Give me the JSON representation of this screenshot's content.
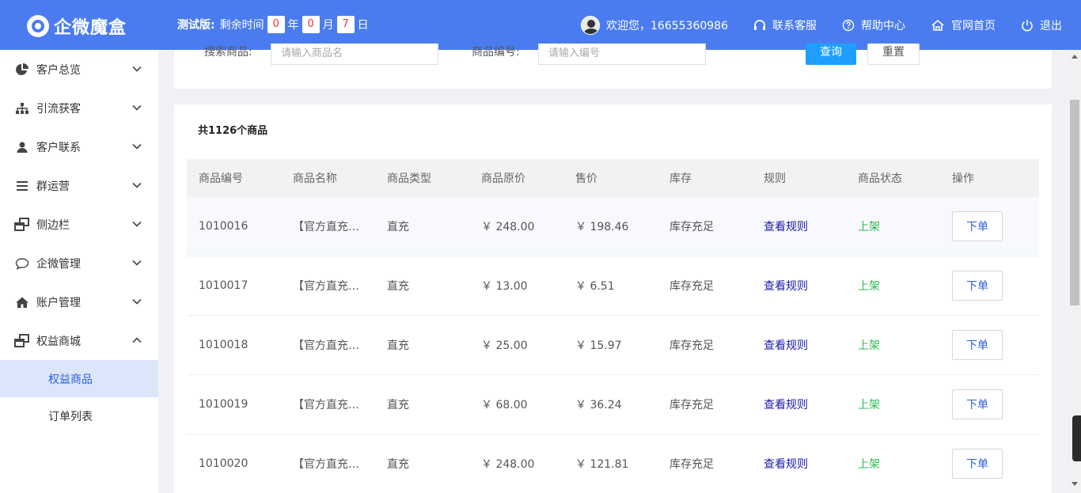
{
  "header": {
    "logo_text": "企微魔盒",
    "trial_label": "测试版:",
    "remaining_label": "剩余时间",
    "years": "0",
    "year_unit": "年",
    "months": "0",
    "month_unit": "月",
    "days": "7",
    "day_unit": "日",
    "welcome": "欢迎您，16655360986",
    "support": "联系客服",
    "help": "帮助中心",
    "home": "官网首页",
    "logout": "退出"
  },
  "sidebar": {
    "items": [
      {
        "label": "客户总览",
        "icon": "pie-chart-icon"
      },
      {
        "label": "引流获客",
        "icon": "sitemap-icon"
      },
      {
        "label": "客户联系",
        "icon": "user-icon"
      },
      {
        "label": "群运营",
        "icon": "list-icon"
      },
      {
        "label": "侧边栏",
        "icon": "windows-icon"
      },
      {
        "label": "企微管理",
        "icon": "chat-bubble-icon"
      },
      {
        "label": "账户管理",
        "icon": "home-icon"
      },
      {
        "label": "权益商城",
        "icon": "windows-icon"
      }
    ],
    "sub_items": [
      {
        "label": "权益商品",
        "active": true
      },
      {
        "label": "订单列表",
        "active": false
      }
    ]
  },
  "search": {
    "product_label": "搜索商品:",
    "product_placeholder": "请输入商品名",
    "code_label": "商品编号:",
    "code_placeholder": "请输入编号",
    "query_button": "查询",
    "reset_button": "重置"
  },
  "table": {
    "count_text": "共1126个商品",
    "headers": [
      "商品编号",
      "商品名称",
      "商品类型",
      "商品原价",
      "售价",
      "库存",
      "规则",
      "商品状态",
      "操作"
    ],
    "rows": [
      {
        "id": "1010016",
        "name": "【官方直充…",
        "type": "直充",
        "orig": "￥ 248.00",
        "price": "￥ 198.46",
        "stock": "库存充足",
        "rule": "查看规则",
        "status": "上架",
        "action": "下单"
      },
      {
        "id": "1010017",
        "name": "【官方直充…",
        "type": "直充",
        "orig": "￥ 13.00",
        "price": "￥ 6.51",
        "stock": "库存充足",
        "rule": "查看规则",
        "status": "上架",
        "action": "下单"
      },
      {
        "id": "1010018",
        "name": "【官方直充…",
        "type": "直充",
        "orig": "￥ 25.00",
        "price": "￥ 15.97",
        "stock": "库存充足",
        "rule": "查看规则",
        "status": "上架",
        "action": "下单"
      },
      {
        "id": "1010019",
        "name": "【官方直充…",
        "type": "直充",
        "orig": "￥ 68.00",
        "price": "￥ 36.24",
        "stock": "库存充足",
        "rule": "查看规则",
        "status": "上架",
        "action": "下单"
      },
      {
        "id": "1010020",
        "name": "【官方直充…",
        "type": "直充",
        "orig": "￥ 248.00",
        "price": "￥ 121.81",
        "stock": "库存充足",
        "rule": "查看规则",
        "status": "上架",
        "action": "下单"
      }
    ]
  },
  "colors": {
    "brand": "#4a7cf0",
    "link": "#1a1aa8",
    "status_on": "#2db84d",
    "query_button": "#1e9fff"
  }
}
